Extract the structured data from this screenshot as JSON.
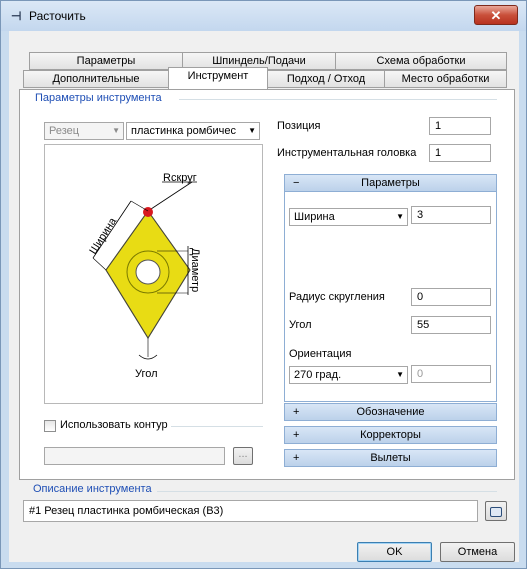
{
  "window": {
    "title": "Расточить",
    "close_glyph": "✕"
  },
  "tabs": {
    "row1": [
      "Параметры",
      "Шпиндель/Подачи",
      "Схема обработки"
    ],
    "row2": [
      "Дополнительные",
      "Инструмент",
      "Подход / Отход",
      "Место обработки"
    ],
    "active": "Инструмент"
  },
  "tool_params": {
    "legend": "Параметры инструмента",
    "type_combo": "Резец",
    "shape_combo": "пластинка ромбичес",
    "position_label": "Позиция",
    "position_value": "1",
    "head_label": "Инструментальная головка",
    "head_value": "1"
  },
  "diagram": {
    "radius_label": "Rскруг",
    "width_label": "Ширина",
    "diameter_label": "Диаметр",
    "angle_label": "Угол",
    "insert_color": "#e8dc14",
    "tip_color": "#d8191f"
  },
  "accordion": {
    "params": {
      "sign": "−",
      "title": "Параметры",
      "param_combo": "Ширина",
      "param_value": "3",
      "radius_label": "Радиус скругления",
      "radius_value": "0",
      "angle_label": "Угол",
      "angle_value": "55",
      "orientation_label": "Ориентация",
      "orientation_combo": "270 град.",
      "orientation_value": "0"
    },
    "collapsed": [
      {
        "sign": "+",
        "title": "Обозначение"
      },
      {
        "sign": "+",
        "title": "Корректоры"
      },
      {
        "sign": "+",
        "title": "Вылеты"
      }
    ]
  },
  "contour": {
    "checkbox_label": "Использовать контур",
    "checked": false,
    "browse": "..."
  },
  "description": {
    "legend": "Описание инструмента",
    "value": "#1 Резец пластинка ромбическая (B3)"
  },
  "buttons": {
    "ok": "OK",
    "cancel": "Отмена"
  }
}
